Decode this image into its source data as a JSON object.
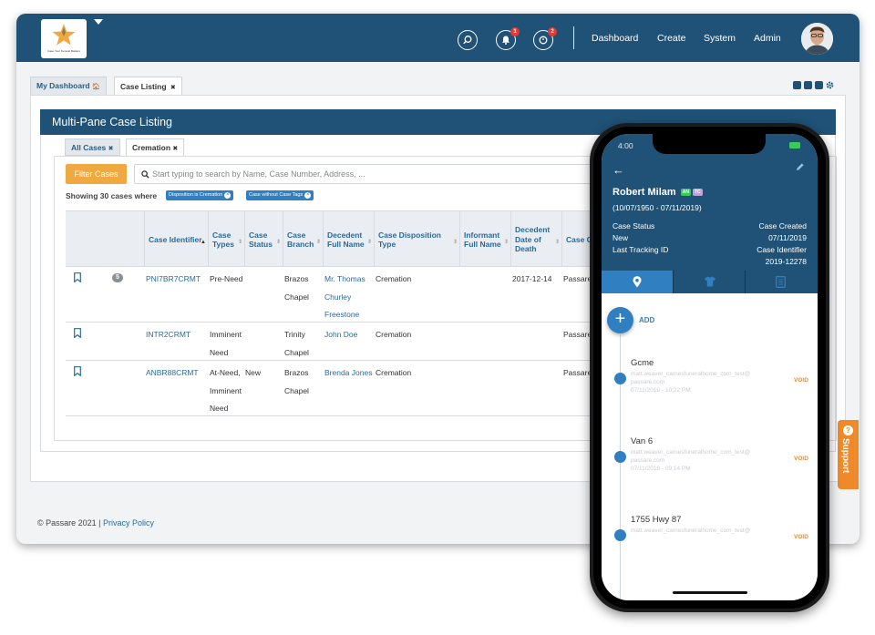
{
  "app": {
    "logo_tagline": "Case Your Funeral Matters",
    "notifications_count": "1",
    "tasks_count": "2",
    "nav": [
      "Dashboard",
      "Create",
      "System",
      "Admin"
    ]
  },
  "tabs": {
    "dashboard_label": "My Dashboard",
    "dashboard_icon": "🏠",
    "case_listing_label": "Case Listing",
    "close_glyph": "✖"
  },
  "panel": {
    "title": "Multi-Pane Case Listing",
    "subtab_all": "All Cases",
    "subtab_cremation": "Cremation",
    "filter_button": "Filter Cases",
    "search_placeholder": "Start typing to search by Name, Case Number, Address, ...",
    "showing_text": "Showing 30 cases where",
    "chips": [
      "Disposition is Cremation",
      "Case without Case Tags"
    ]
  },
  "table": {
    "headers": [
      "Case Identifier",
      "Case Types",
      "Case Status",
      "Case Branch",
      "Decedent Full Name",
      "Case Disposition Type",
      "Informant Full Name",
      "Decedent Date of Death",
      "Case O"
    ],
    "rows": [
      {
        "badge": "5",
        "id": "PNI7BR7CRMT",
        "types": [
          "Pre-Need"
        ],
        "status": "",
        "branch": [
          "Brazos",
          "Chapel"
        ],
        "decedent": [
          "Mr. Thomas",
          "Churley",
          "Freestone"
        ],
        "disposition": "Cremation",
        "informant": "",
        "dod": "2017-12-14",
        "owner": "Passare"
      },
      {
        "badge": "",
        "id": "INTR2CRMT",
        "types": [
          "Imminent",
          "Need"
        ],
        "status": "",
        "branch": [
          "Trinity",
          "Chapel"
        ],
        "decedent": [
          "John Doe"
        ],
        "disposition": "Cremation",
        "informant": "",
        "dod": "",
        "owner": "Passare"
      },
      {
        "badge": "",
        "id": "ANBR88CRMT",
        "types": [
          "At-Need,",
          "Imminent",
          "Need"
        ],
        "status": "New",
        "branch": [
          "Brazos",
          "Chapel"
        ],
        "decedent": [
          "Brenda Jones"
        ],
        "disposition": "Cremation",
        "informant": "",
        "dod": "",
        "owner": "Passare"
      }
    ]
  },
  "footer": {
    "copyright": "© Passare 2021 |",
    "privacy": "Privacy Policy"
  },
  "support": {
    "label": "Support",
    "q": "?"
  },
  "mobile": {
    "time": "4:00",
    "name": "Robert Milam",
    "tag1": "AN",
    "tag2": "TC",
    "dates": "(10/07/1950 - 07/11/2019)",
    "status_label": "Case Status",
    "created_label": "Case Created",
    "status_value": "New",
    "created_value": "07/11/2019",
    "tracking_label": "Last Tracking ID",
    "identifier_label": "Case Identifier",
    "identifier_value": "2019-12278",
    "add_label": "ADD",
    "items": [
      {
        "title": "Gcme",
        "email1": "matt.weaver_carnesfuneralhome_com_test@",
        "email2": "passare.com",
        "date": "07/11/2019 - 10:22 PM",
        "void": "VOID"
      },
      {
        "title": "Van 6",
        "email1": "matt.weaver_carnesfuneralhome_com_test@",
        "email2": "passare.com",
        "date": "07/11/2019 - 09:14 PM",
        "void": "VOID"
      },
      {
        "title": "1755 Hwy 87",
        "email1": "matt.weaver_carnesfuneralhome_com_test@",
        "email2": "",
        "date": "",
        "void": "VOID"
      }
    ]
  }
}
